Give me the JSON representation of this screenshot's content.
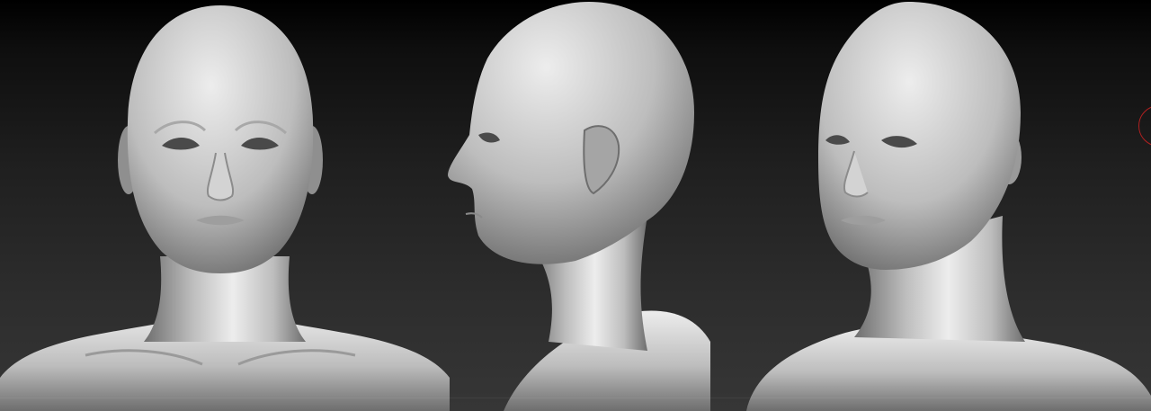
{
  "canvas": {
    "background_top": "#000000",
    "background_bottom": "#363636",
    "clay_light": "#ededed",
    "clay_mid": "#bdbdbd",
    "clay_dark": "#6e6e6e",
    "marker_color": "#b02020"
  },
  "views": [
    {
      "name": "front-view"
    },
    {
      "name": "side-view"
    },
    {
      "name": "three-quarter-view"
    }
  ],
  "icons": {
    "corner_marker": "circle-outline-icon"
  }
}
